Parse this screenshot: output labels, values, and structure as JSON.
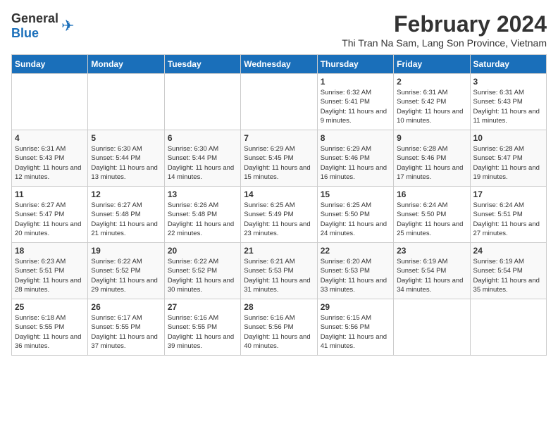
{
  "header": {
    "logo": {
      "general": "General",
      "blue": "Blue"
    },
    "title": "February 2024",
    "location": "Thi Tran Na Sam, Lang Son Province, Vietnam"
  },
  "weekdays": [
    "Sunday",
    "Monday",
    "Tuesday",
    "Wednesday",
    "Thursday",
    "Friday",
    "Saturday"
  ],
  "weeks": [
    [
      {
        "day": "",
        "sunrise": "",
        "sunset": "",
        "daylight": ""
      },
      {
        "day": "",
        "sunrise": "",
        "sunset": "",
        "daylight": ""
      },
      {
        "day": "",
        "sunrise": "",
        "sunset": "",
        "daylight": ""
      },
      {
        "day": "",
        "sunrise": "",
        "sunset": "",
        "daylight": ""
      },
      {
        "day": "1",
        "sunrise": "Sunrise: 6:32 AM",
        "sunset": "Sunset: 5:41 PM",
        "daylight": "Daylight: 11 hours and 9 minutes."
      },
      {
        "day": "2",
        "sunrise": "Sunrise: 6:31 AM",
        "sunset": "Sunset: 5:42 PM",
        "daylight": "Daylight: 11 hours and 10 minutes."
      },
      {
        "day": "3",
        "sunrise": "Sunrise: 6:31 AM",
        "sunset": "Sunset: 5:43 PM",
        "daylight": "Daylight: 11 hours and 11 minutes."
      }
    ],
    [
      {
        "day": "4",
        "sunrise": "Sunrise: 6:31 AM",
        "sunset": "Sunset: 5:43 PM",
        "daylight": "Daylight: 11 hours and 12 minutes."
      },
      {
        "day": "5",
        "sunrise": "Sunrise: 6:30 AM",
        "sunset": "Sunset: 5:44 PM",
        "daylight": "Daylight: 11 hours and 13 minutes."
      },
      {
        "day": "6",
        "sunrise": "Sunrise: 6:30 AM",
        "sunset": "Sunset: 5:44 PM",
        "daylight": "Daylight: 11 hours and 14 minutes."
      },
      {
        "day": "7",
        "sunrise": "Sunrise: 6:29 AM",
        "sunset": "Sunset: 5:45 PM",
        "daylight": "Daylight: 11 hours and 15 minutes."
      },
      {
        "day": "8",
        "sunrise": "Sunrise: 6:29 AM",
        "sunset": "Sunset: 5:46 PM",
        "daylight": "Daylight: 11 hours and 16 minutes."
      },
      {
        "day": "9",
        "sunrise": "Sunrise: 6:28 AM",
        "sunset": "Sunset: 5:46 PM",
        "daylight": "Daylight: 11 hours and 17 minutes."
      },
      {
        "day": "10",
        "sunrise": "Sunrise: 6:28 AM",
        "sunset": "Sunset: 5:47 PM",
        "daylight": "Daylight: 11 hours and 19 minutes."
      }
    ],
    [
      {
        "day": "11",
        "sunrise": "Sunrise: 6:27 AM",
        "sunset": "Sunset: 5:47 PM",
        "daylight": "Daylight: 11 hours and 20 minutes."
      },
      {
        "day": "12",
        "sunrise": "Sunrise: 6:27 AM",
        "sunset": "Sunset: 5:48 PM",
        "daylight": "Daylight: 11 hours and 21 minutes."
      },
      {
        "day": "13",
        "sunrise": "Sunrise: 6:26 AM",
        "sunset": "Sunset: 5:48 PM",
        "daylight": "Daylight: 11 hours and 22 minutes."
      },
      {
        "day": "14",
        "sunrise": "Sunrise: 6:25 AM",
        "sunset": "Sunset: 5:49 PM",
        "daylight": "Daylight: 11 hours and 23 minutes."
      },
      {
        "day": "15",
        "sunrise": "Sunrise: 6:25 AM",
        "sunset": "Sunset: 5:50 PM",
        "daylight": "Daylight: 11 hours and 24 minutes."
      },
      {
        "day": "16",
        "sunrise": "Sunrise: 6:24 AM",
        "sunset": "Sunset: 5:50 PM",
        "daylight": "Daylight: 11 hours and 25 minutes."
      },
      {
        "day": "17",
        "sunrise": "Sunrise: 6:24 AM",
        "sunset": "Sunset: 5:51 PM",
        "daylight": "Daylight: 11 hours and 27 minutes."
      }
    ],
    [
      {
        "day": "18",
        "sunrise": "Sunrise: 6:23 AM",
        "sunset": "Sunset: 5:51 PM",
        "daylight": "Daylight: 11 hours and 28 minutes."
      },
      {
        "day": "19",
        "sunrise": "Sunrise: 6:22 AM",
        "sunset": "Sunset: 5:52 PM",
        "daylight": "Daylight: 11 hours and 29 minutes."
      },
      {
        "day": "20",
        "sunrise": "Sunrise: 6:22 AM",
        "sunset": "Sunset: 5:52 PM",
        "daylight": "Daylight: 11 hours and 30 minutes."
      },
      {
        "day": "21",
        "sunrise": "Sunrise: 6:21 AM",
        "sunset": "Sunset: 5:53 PM",
        "daylight": "Daylight: 11 hours and 31 minutes."
      },
      {
        "day": "22",
        "sunrise": "Sunrise: 6:20 AM",
        "sunset": "Sunset: 5:53 PM",
        "daylight": "Daylight: 11 hours and 33 minutes."
      },
      {
        "day": "23",
        "sunrise": "Sunrise: 6:19 AM",
        "sunset": "Sunset: 5:54 PM",
        "daylight": "Daylight: 11 hours and 34 minutes."
      },
      {
        "day": "24",
        "sunrise": "Sunrise: 6:19 AM",
        "sunset": "Sunset: 5:54 PM",
        "daylight": "Daylight: 11 hours and 35 minutes."
      }
    ],
    [
      {
        "day": "25",
        "sunrise": "Sunrise: 6:18 AM",
        "sunset": "Sunset: 5:55 PM",
        "daylight": "Daylight: 11 hours and 36 minutes."
      },
      {
        "day": "26",
        "sunrise": "Sunrise: 6:17 AM",
        "sunset": "Sunset: 5:55 PM",
        "daylight": "Daylight: 11 hours and 37 minutes."
      },
      {
        "day": "27",
        "sunrise": "Sunrise: 6:16 AM",
        "sunset": "Sunset: 5:55 PM",
        "daylight": "Daylight: 11 hours and 39 minutes."
      },
      {
        "day": "28",
        "sunrise": "Sunrise: 6:16 AM",
        "sunset": "Sunset: 5:56 PM",
        "daylight": "Daylight: 11 hours and 40 minutes."
      },
      {
        "day": "29",
        "sunrise": "Sunrise: 6:15 AM",
        "sunset": "Sunset: 5:56 PM",
        "daylight": "Daylight: 11 hours and 41 minutes."
      },
      {
        "day": "",
        "sunrise": "",
        "sunset": "",
        "daylight": ""
      },
      {
        "day": "",
        "sunrise": "",
        "sunset": "",
        "daylight": ""
      }
    ]
  ]
}
